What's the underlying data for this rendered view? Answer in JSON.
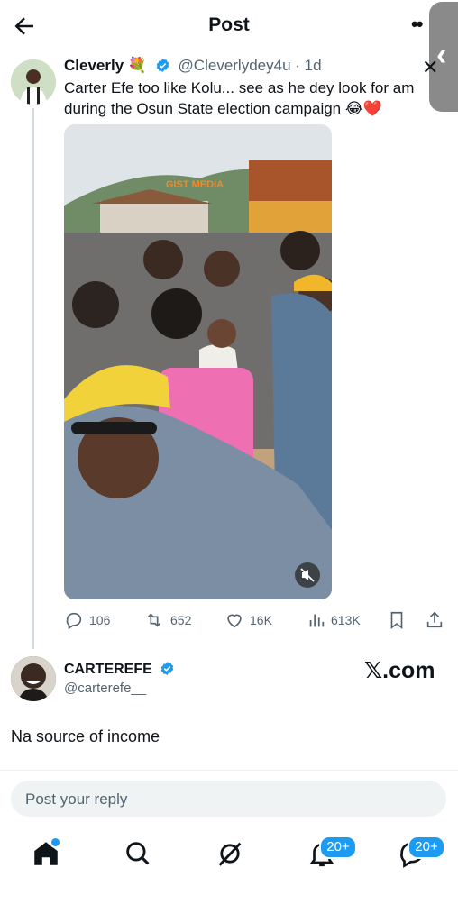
{
  "header": {
    "title": "Post"
  },
  "tweet": {
    "author_name": "Cleverly",
    "author_emoji": "💐",
    "handle": "@Cleverlydey4u",
    "separator": "·",
    "age": "1d",
    "text": "Carter Efe too like Kolu... see as he dey look for am during the Osun State election campaign 😂❤️",
    "media_watermark": "GIST MEDIA"
  },
  "stats": {
    "replies": "106",
    "reposts": "652",
    "likes": "16K",
    "views": "613K"
  },
  "reply": {
    "author_name": "CARTEREFE",
    "handle": "@carterefe__",
    "brand": "𝕏.com",
    "text": "Na source of income"
  },
  "composer": {
    "placeholder": "Post your reply"
  },
  "nav": {
    "notifications_badge": "20+",
    "messages_badge": "20+"
  },
  "colors": {
    "accent": "#1d9bf0",
    "muted": "#536471"
  }
}
